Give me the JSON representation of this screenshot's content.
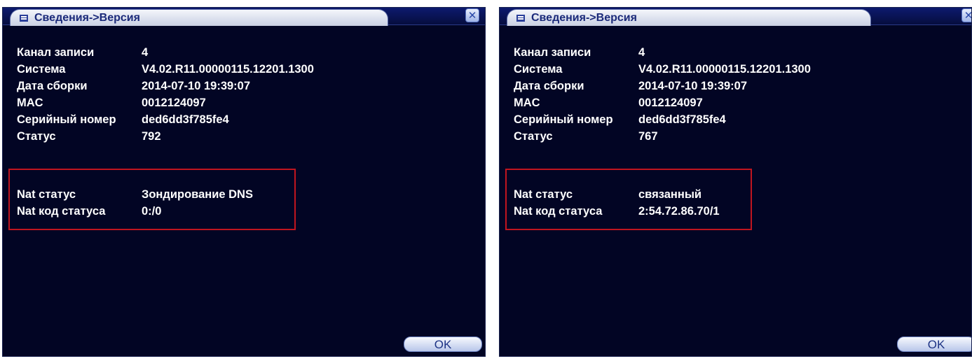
{
  "windows": [
    {
      "title": "Сведения->Версия",
      "close": "✕",
      "info": [
        {
          "label": "Канал записи",
          "value": "4"
        },
        {
          "label": "Система",
          "value": "V4.02.R11.00000115.12201.1300"
        },
        {
          "label": "Дата сборки",
          "value": "2014-07-10 19:39:07"
        },
        {
          "label": "MAC",
          "value": "0012124097"
        },
        {
          "label": "Серийный номер",
          "value": "ded6dd3f785fe4"
        },
        {
          "label": "Статус",
          "value": "792"
        }
      ],
      "nat": [
        {
          "label": "Nat статус",
          "value": "Зондирование DNS"
        },
        {
          "label": "Nat код статуса",
          "value": "0:/0"
        }
      ],
      "ok": "OK"
    },
    {
      "title": "Сведения->Версия",
      "close": "✕",
      "info": [
        {
          "label": "Канал записи",
          "value": "4"
        },
        {
          "label": "Система",
          "value": "V4.02.R11.00000115.12201.1300"
        },
        {
          "label": "Дата сборки",
          "value": "2014-07-10 19:39:07"
        },
        {
          "label": "MAC",
          "value": "0012124097"
        },
        {
          "label": "Серийный номер",
          "value": "ded6dd3f785fe4"
        },
        {
          "label": "Статус",
          "value": "767"
        }
      ],
      "nat": [
        {
          "label": "Nat статус",
          "value": "связанный"
        },
        {
          "label": "Nat код статуса",
          "value": "2:54.72.86.70/1"
        }
      ],
      "ok": "OK"
    }
  ],
  "colors": {
    "background": "#020524",
    "text": "#ffffff",
    "highlight_border": "#c0151f",
    "title_text": "#1b2a7a"
  }
}
